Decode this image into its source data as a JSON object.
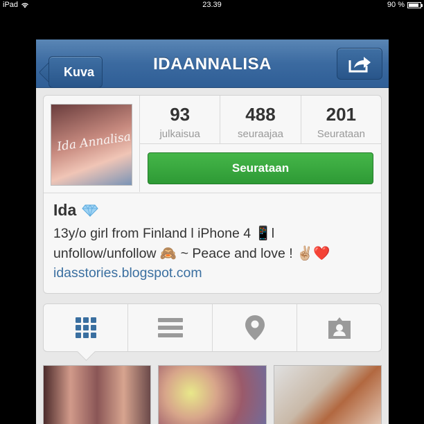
{
  "status_bar": {
    "device": "iPad",
    "time": "23.39",
    "battery": "90 %",
    "battery_level": 0.9
  },
  "navbar": {
    "back_label": "Kuva",
    "title": "IDAANNALISA"
  },
  "profile": {
    "avatar_caption": "Ida Annalisa",
    "stats": [
      {
        "value": "93",
        "label": "julkaisua"
      },
      {
        "value": "488",
        "label": "seuraajaa"
      },
      {
        "value": "201",
        "label": "Seurataan"
      }
    ],
    "follow_label": "Seurataan",
    "name": "Ida",
    "bio_line1": "13y/o girl from Finland l iPhone 4 📱l",
    "bio_line2": "unfollow/unfollow 🙈 ~ Peace and love ! ✌🏼❤️",
    "website": "idasstories.blogspot.com"
  },
  "tabs": [
    {
      "icon": "grid-icon",
      "active": true
    },
    {
      "icon": "list-icon",
      "active": false
    },
    {
      "icon": "location-pin-icon",
      "active": false
    },
    {
      "icon": "tagged-photos-icon",
      "active": false
    }
  ],
  "colors": {
    "nav": "#3b6aa0",
    "follow": "#2e9a35",
    "link": "#3a6fa0",
    "tab_active": "#3a6fa0",
    "tab_inactive": "#9a9a9a"
  }
}
